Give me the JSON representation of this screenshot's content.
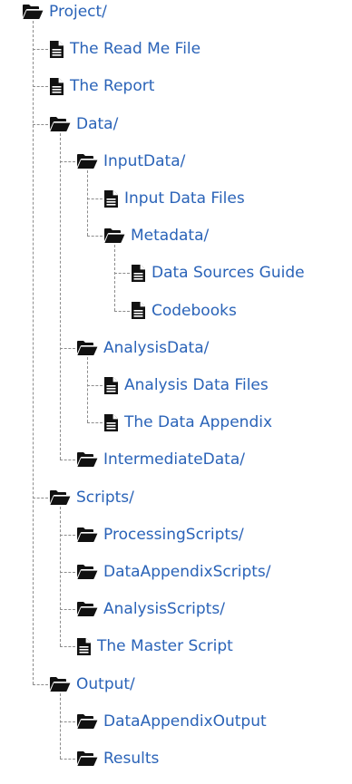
{
  "tree": {
    "label": "Project/",
    "type": "folder",
    "children": [
      {
        "label": "The Read Me File",
        "type": "file"
      },
      {
        "label": "The Report",
        "type": "file"
      },
      {
        "label": "Data/",
        "type": "folder",
        "children": [
          {
            "label": "InputData/",
            "type": "folder",
            "children": [
              {
                "label": "Input Data Files",
                "type": "file"
              },
              {
                "label": "Metadata/",
                "type": "folder",
                "children": [
                  {
                    "label": "Data Sources Guide",
                    "type": "file"
                  },
                  {
                    "label": "Codebooks",
                    "type": "file"
                  }
                ]
              }
            ]
          },
          {
            "label": "AnalysisData/",
            "type": "folder",
            "children": [
              {
                "label": "Analysis Data Files",
                "type": "file"
              },
              {
                "label": "The Data Appendix",
                "type": "file"
              }
            ]
          },
          {
            "label": "IntermediateData/",
            "type": "folder",
            "children": []
          }
        ]
      },
      {
        "label": "Scripts/",
        "type": "folder",
        "children": [
          {
            "label": "ProcessingScripts/",
            "type": "folder",
            "children": []
          },
          {
            "label": "DataAppendixScripts/",
            "type": "folder",
            "children": []
          },
          {
            "label": "AnalysisScripts/",
            "type": "folder",
            "children": []
          },
          {
            "label": "The Master Script",
            "type": "file"
          }
        ]
      },
      {
        "label": "Output/",
        "type": "folder",
        "children": [
          {
            "label": "DataAppendixOutput",
            "type": "folder",
            "children": []
          },
          {
            "label": "Results",
            "type": "folder",
            "children": []
          }
        ]
      }
    ]
  },
  "icons": {
    "folder": "folder-open-icon",
    "file": "file-text-icon"
  },
  "colors": {
    "link": "#2a63b8",
    "icon": "#111111",
    "guide": "#8c8c8c"
  }
}
